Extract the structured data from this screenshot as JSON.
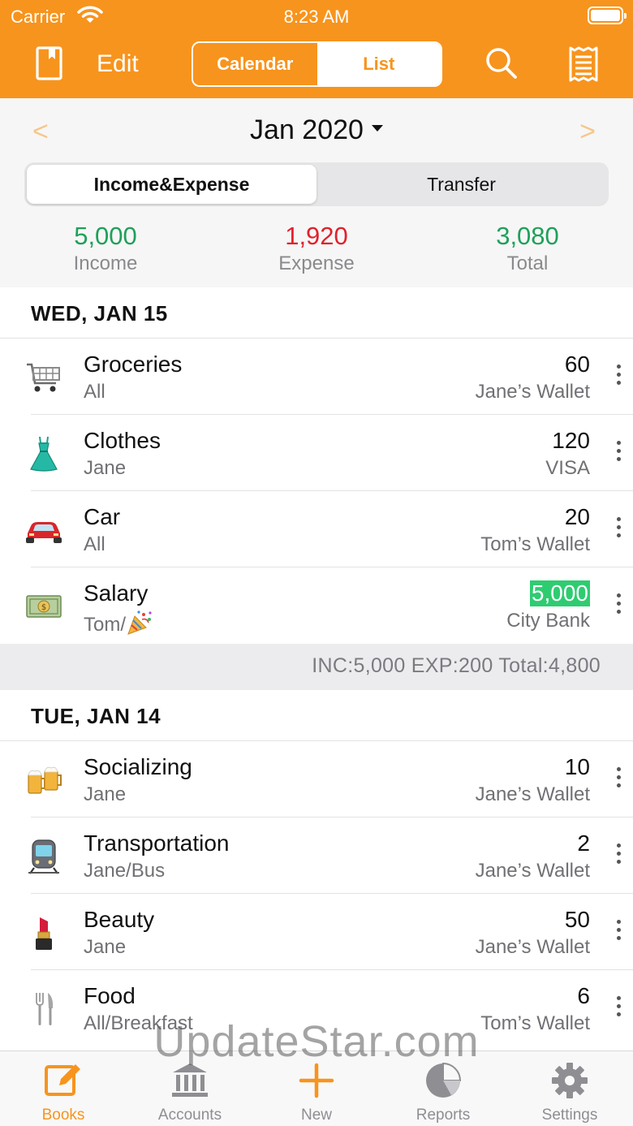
{
  "status_bar": {
    "carrier": "Carrier",
    "time": "8:23 AM"
  },
  "header": {
    "edit_label": "Edit",
    "view_toggle": {
      "options": [
        "Calendar",
        "List"
      ],
      "selected": "List"
    },
    "accent_color": "#f7941d"
  },
  "month_nav": {
    "label": "Jan 2020"
  },
  "type_toggle": {
    "options": [
      "Income&Expense",
      "Transfer"
    ],
    "selected": "Income&Expense"
  },
  "totals": [
    {
      "value": "5,000",
      "label": "Income",
      "color": "#1fa05a"
    },
    {
      "value": "1,920",
      "label": "Expense",
      "color": "#e0212c"
    },
    {
      "value": "3,080",
      "label": "Total",
      "color": "#1fa05a"
    }
  ],
  "days": [
    {
      "date": "WED, JAN 15",
      "items": [
        {
          "icon": "shopping-cart-icon",
          "name": "Groceries",
          "sub": "All",
          "amount": "60",
          "account": "Jane’s Wallet"
        },
        {
          "icon": "dress-icon",
          "name": "Clothes",
          "sub": "Jane",
          "amount": "120",
          "account": "VISA"
        },
        {
          "icon": "car-icon",
          "name": "Car",
          "sub": "All",
          "amount": "20",
          "account": "Tom’s Wallet"
        },
        {
          "icon": "money-icon",
          "name": "Salary",
          "sub": "Tom/",
          "amount": "5,000",
          "account": "City Bank",
          "highlight": true
        }
      ],
      "summary": "INC:5,000  EXP:200  Total:4,800"
    },
    {
      "date": "TUE, JAN 14",
      "items": [
        {
          "icon": "beer-mugs-icon",
          "name": "Socializing",
          "sub": "Jane",
          "amount": "10",
          "account": "Jane’s Wallet"
        },
        {
          "icon": "train-icon",
          "name": "Transportation",
          "sub": "Jane/Bus",
          "amount": "2",
          "account": "Jane’s Wallet"
        },
        {
          "icon": "lipstick-icon",
          "name": "Beauty",
          "sub": "Jane",
          "amount": "50",
          "account": "Jane’s Wallet"
        },
        {
          "icon": "fork-knife-icon",
          "name": "Food",
          "sub": "All/Breakfast",
          "amount": "6",
          "account": "Tom’s Wallet"
        }
      ]
    }
  ],
  "tabbar": {
    "items": [
      {
        "label": "Books",
        "icon": "book-edit-icon",
        "active": true
      },
      {
        "label": "Accounts",
        "icon": "bank-icon"
      },
      {
        "label": "New",
        "icon": "plus-icon"
      },
      {
        "label": "Reports",
        "icon": "pie-chart-icon"
      },
      {
        "label": "Settings",
        "icon": "gear-icon"
      }
    ]
  },
  "watermark": "UpdateStar.com"
}
